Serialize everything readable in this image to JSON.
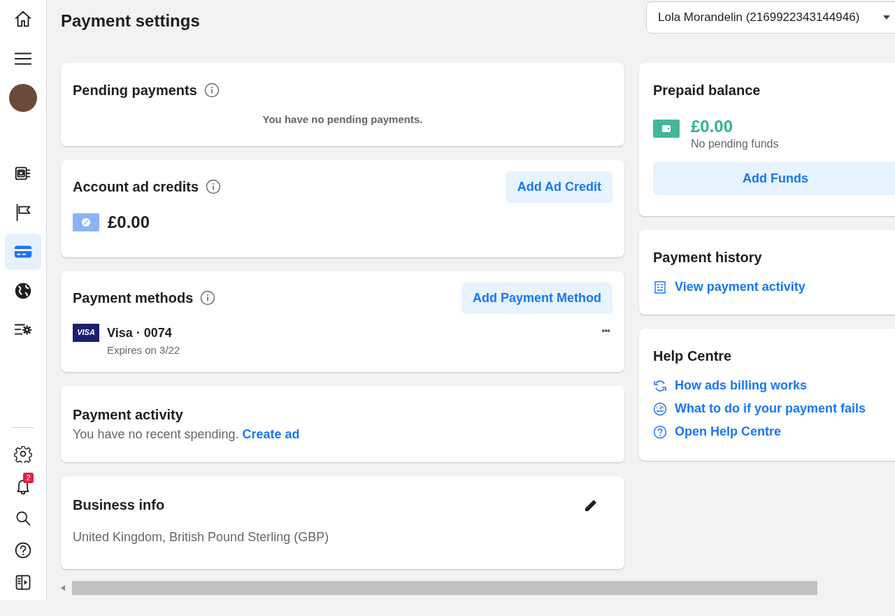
{
  "sidebar": {
    "top_items": [
      {
        "kind": "home",
        "selected": false
      },
      {
        "kind": "menu",
        "selected": false
      },
      {
        "kind": "avatar",
        "selected": false
      }
    ],
    "nav_items": [
      {
        "kind": "pages",
        "selected": false
      },
      {
        "kind": "flag",
        "selected": false
      },
      {
        "kind": "card",
        "selected": true
      },
      {
        "kind": "globe",
        "selected": false
      },
      {
        "kind": "list-settings",
        "selected": false
      }
    ],
    "bottom_items": [
      {
        "kind": "gear"
      },
      {
        "kind": "bell",
        "badge": "2"
      },
      {
        "kind": "search"
      },
      {
        "kind": "help"
      },
      {
        "kind": "panel"
      }
    ]
  },
  "page_title": "Payment settings",
  "account_selector": {
    "value": "Lola Morandelin (2169922343144946)"
  },
  "pending_payments": {
    "title": "Pending payments",
    "message": "You have no pending payments."
  },
  "ad_credits": {
    "title": "Account ad credits",
    "button": "Add Ad Credit",
    "amount": "£0.00"
  },
  "payment_methods": {
    "title": "Payment methods",
    "button": "Add Payment Method",
    "methods": [
      {
        "brand": "VISA",
        "name": "Visa · 0074",
        "expiry": "Expires on 3/22",
        "more": "•••"
      }
    ]
  },
  "payment_activity": {
    "title": "Payment activity",
    "message": "You have no recent spending.",
    "link": "Create ad"
  },
  "business_info": {
    "title": "Business info",
    "details": "United Kingdom, British Pound Sterling (GBP)"
  },
  "prepaid_balance": {
    "title": "Prepaid balance",
    "amount": "£0.00",
    "note": "No pending funds",
    "button": "Add Funds"
  },
  "payment_history": {
    "title": "Payment history",
    "links": [
      {
        "kind": "receipt",
        "label": "View payment activity"
      }
    ]
  },
  "help_centre": {
    "title": "Help Centre",
    "links": [
      {
        "kind": "refresh",
        "label": "How ads billing works"
      },
      {
        "kind": "gauge",
        "label": "What to do if your payment fails"
      },
      {
        "kind": "question",
        "label": "Open Help Centre"
      }
    ]
  }
}
